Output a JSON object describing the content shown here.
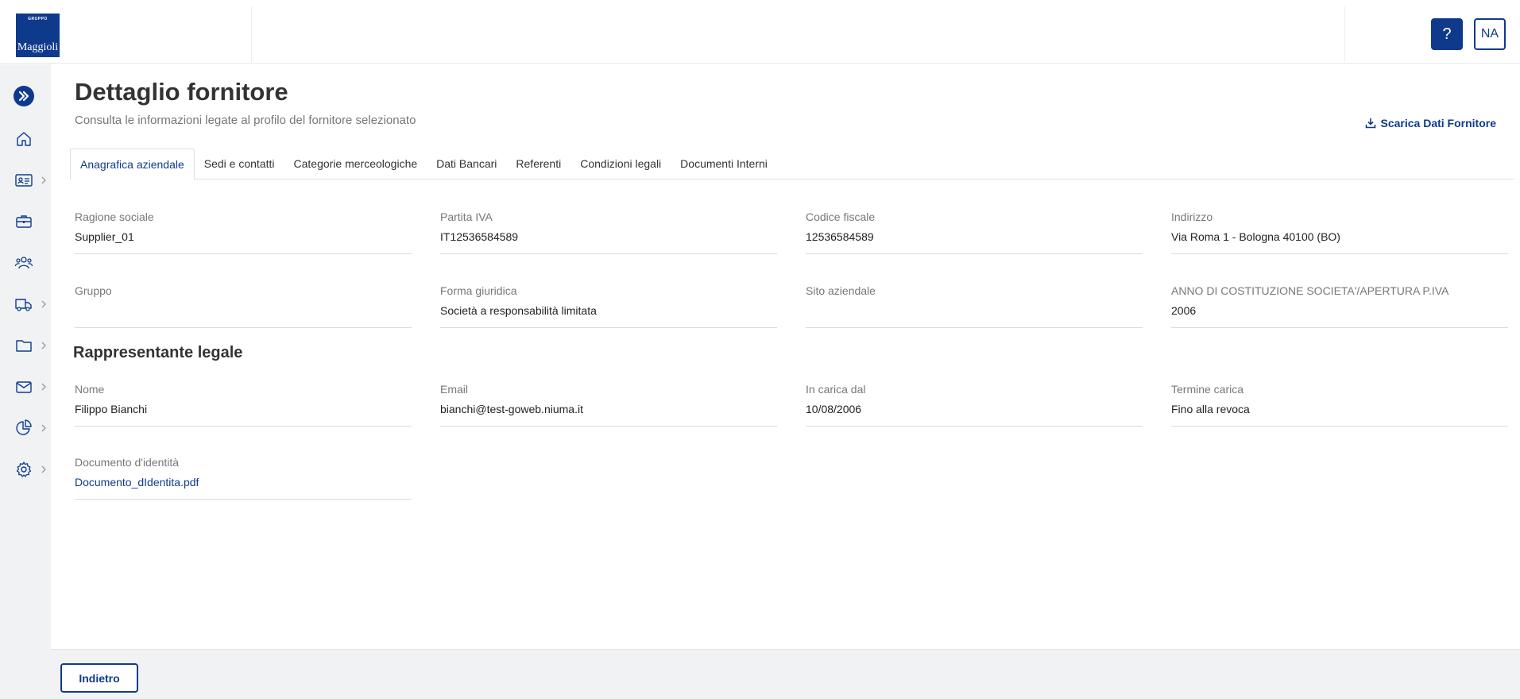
{
  "header": {
    "logo_small": "GRUPPO",
    "logo_big": "Maggioli",
    "help_label": "?",
    "user_initials": "NA"
  },
  "sidebar": {
    "items": [
      {
        "icon": "home-icon",
        "has_chevron": false
      },
      {
        "icon": "id-card-icon",
        "has_chevron": true
      },
      {
        "icon": "briefcase-icon",
        "has_chevron": false
      },
      {
        "icon": "users-icon",
        "has_chevron": false
      },
      {
        "icon": "truck-icon",
        "has_chevron": true
      },
      {
        "icon": "folder-icon",
        "has_chevron": true
      },
      {
        "icon": "mail-icon",
        "has_chevron": true
      },
      {
        "icon": "pie-chart-icon",
        "has_chevron": true
      },
      {
        "icon": "gear-icon",
        "has_chevron": true
      }
    ]
  },
  "page": {
    "title": "Dettaglio fornitore",
    "subtitle": "Consulta le informazioni legate al profilo del fornitore selezionato",
    "download_label": "Scarica Dati Fornitore"
  },
  "tabs": [
    {
      "label": "Anagrafica aziendale",
      "active": true
    },
    {
      "label": "Sedi e contatti",
      "active": false
    },
    {
      "label": "Categorie merceologiche",
      "active": false
    },
    {
      "label": "Dati Bancari",
      "active": false
    },
    {
      "label": "Referenti",
      "active": false
    },
    {
      "label": "Condizioni legali",
      "active": false
    },
    {
      "label": "Documenti Interni",
      "active": false
    }
  ],
  "company": {
    "ragione_sociale": {
      "label": "Ragione sociale",
      "value": "Supplier_01"
    },
    "partita_iva": {
      "label": "Partita IVA",
      "value": "IT12536584589"
    },
    "codice_fiscale": {
      "label": "Codice fiscale",
      "value": "12536584589"
    },
    "indirizzo": {
      "label": "Indirizzo",
      "value": "Via Roma 1 - Bologna 40100 (BO)"
    },
    "gruppo": {
      "label": "Gruppo",
      "value": ""
    },
    "forma_giuridica": {
      "label": "Forma giuridica",
      "value": "Società a responsabilità limitata"
    },
    "sito_aziendale": {
      "label": "Sito aziendale",
      "value": ""
    },
    "anno_costituzione": {
      "label": "ANNO DI COSTITUZIONE SOCIETA'/APERTURA P.IVA",
      "value": "2006"
    }
  },
  "legal_rep": {
    "section_title": "Rappresentante legale",
    "nome": {
      "label": "Nome",
      "value": "Filippo Bianchi"
    },
    "email": {
      "label": "Email",
      "value": "bianchi@test-goweb.niuma.it"
    },
    "in_carica_dal": {
      "label": "In carica dal",
      "value": "10/08/2006"
    },
    "termine_carica": {
      "label": "Termine carica",
      "value": "Fino alla revoca"
    },
    "documento": {
      "label": "Documento d'identità",
      "value": "Documento_dIdentita.pdf"
    }
  },
  "footer": {
    "back_label": "Indietro"
  },
  "colors": {
    "primary": "#0f3a8c",
    "sidebar_bg": "#f0f2f4",
    "label_gray": "#777777"
  }
}
